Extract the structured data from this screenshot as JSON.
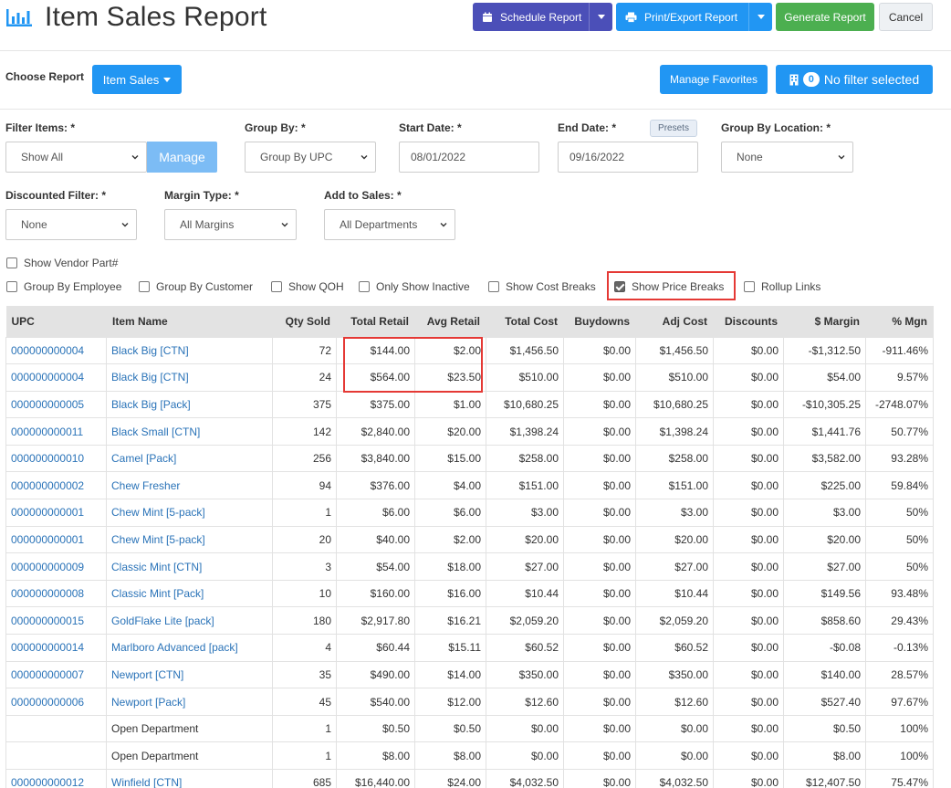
{
  "header": {
    "title": "Item Sales Report",
    "schedule_label": "Schedule Report",
    "print_label": "Print/Export Report",
    "generate_label": "Generate Report",
    "cancel_label": "Cancel"
  },
  "choose": {
    "label": "Choose Report",
    "report_value": "Item Sales",
    "manage_favorites": "Manage Favorites",
    "filter_count": "0",
    "filter_text": "No filter selected"
  },
  "filters": {
    "filter_items_label": "Filter Items: *",
    "filter_items_value": "Show All",
    "manage_label": "Manage",
    "group_by_label": "Group By: *",
    "group_by_value": "Group By UPC",
    "start_date_label": "Start Date: *",
    "start_date_value": "08/01/2022",
    "end_date_label": "End Date: *",
    "end_date_value": "09/16/2022",
    "presets_label": "Presets",
    "group_loc_label": "Group By Location: *",
    "group_loc_value": "None",
    "discounted_label": "Discounted Filter: *",
    "discounted_value": "None",
    "margin_label": "Margin Type: *",
    "margin_value": "All Margins",
    "add_sales_label": "Add to Sales: *",
    "add_sales_value": "All Departments"
  },
  "checkboxes": {
    "vendor_part": {
      "label": "Show Vendor Part#",
      "checked": false
    },
    "group_employee": {
      "label": "Group By Employee",
      "checked": false
    },
    "group_customer": {
      "label": "Group By Customer",
      "checked": false
    },
    "show_qoh": {
      "label": "Show QOH",
      "checked": false
    },
    "only_inactive": {
      "label": "Only Show Inactive",
      "checked": false
    },
    "cost_breaks": {
      "label": "Show Cost Breaks",
      "checked": false
    },
    "price_breaks": {
      "label": "Show Price Breaks",
      "checked": true
    },
    "rollup_links": {
      "label": "Rollup Links",
      "checked": false
    }
  },
  "table": {
    "columns": [
      "UPC",
      "Item Name",
      "Qty Sold",
      "Total Retail",
      "Avg Retail",
      "Total Cost",
      "Buydowns",
      "Adj Cost",
      "Discounts",
      "$ Margin",
      "% Mgn"
    ],
    "rows": [
      [
        "000000000004",
        "Black Big [CTN]",
        "72",
        "$144.00",
        "$2.00",
        "$1,456.50",
        "$0.00",
        "$1,456.50",
        "$0.00",
        "-$1,312.50",
        "-911.46%"
      ],
      [
        "000000000004",
        "Black Big [CTN]",
        "24",
        "$564.00",
        "$23.50",
        "$510.00",
        "$0.00",
        "$510.00",
        "$0.00",
        "$54.00",
        "9.57%"
      ],
      [
        "000000000005",
        "Black Big [Pack]",
        "375",
        "$375.00",
        "$1.00",
        "$10,680.25",
        "$0.00",
        "$10,680.25",
        "$0.00",
        "-$10,305.25",
        "-2748.07%"
      ],
      [
        "000000000011",
        "Black Small [CTN]",
        "142",
        "$2,840.00",
        "$20.00",
        "$1,398.24",
        "$0.00",
        "$1,398.24",
        "$0.00",
        "$1,441.76",
        "50.77%"
      ],
      [
        "000000000010",
        "Camel [Pack]",
        "256",
        "$3,840.00",
        "$15.00",
        "$258.00",
        "$0.00",
        "$258.00",
        "$0.00",
        "$3,582.00",
        "93.28%"
      ],
      [
        "000000000002",
        "Chew Fresher",
        "94",
        "$376.00",
        "$4.00",
        "$151.00",
        "$0.00",
        "$151.00",
        "$0.00",
        "$225.00",
        "59.84%"
      ],
      [
        "000000000001",
        "Chew Mint [5-pack]",
        "1",
        "$6.00",
        "$6.00",
        "$3.00",
        "$0.00",
        "$3.00",
        "$0.00",
        "$3.00",
        "50%"
      ],
      [
        "000000000001",
        "Chew Mint [5-pack]",
        "20",
        "$40.00",
        "$2.00",
        "$20.00",
        "$0.00",
        "$20.00",
        "$0.00",
        "$20.00",
        "50%"
      ],
      [
        "000000000009",
        "Classic Mint [CTN]",
        "3",
        "$54.00",
        "$18.00",
        "$27.00",
        "$0.00",
        "$27.00",
        "$0.00",
        "$27.00",
        "50%"
      ],
      [
        "000000000008",
        "Classic Mint [Pack]",
        "10",
        "$160.00",
        "$16.00",
        "$10.44",
        "$0.00",
        "$10.44",
        "$0.00",
        "$149.56",
        "93.48%"
      ],
      [
        "000000000015",
        "GoldFlake Lite [pack]",
        "180",
        "$2,917.80",
        "$16.21",
        "$2,059.20",
        "$0.00",
        "$2,059.20",
        "$0.00",
        "$858.60",
        "29.43%"
      ],
      [
        "000000000014",
        "Marlboro Advanced [pack]",
        "4",
        "$60.44",
        "$15.11",
        "$60.52",
        "$0.00",
        "$60.52",
        "$0.00",
        "-$0.08",
        "-0.13%"
      ],
      [
        "000000000007",
        "Newport [CTN]",
        "35",
        "$490.00",
        "$14.00",
        "$350.00",
        "$0.00",
        "$350.00",
        "$0.00",
        "$140.00",
        "28.57%"
      ],
      [
        "000000000006",
        "Newport [Pack]",
        "45",
        "$540.00",
        "$12.00",
        "$12.60",
        "$0.00",
        "$12.60",
        "$0.00",
        "$527.40",
        "97.67%"
      ],
      [
        "",
        "Open Department",
        "1",
        "$0.50",
        "$0.50",
        "$0.00",
        "$0.00",
        "$0.00",
        "$0.00",
        "$0.50",
        "100%"
      ],
      [
        "",
        "Open Department",
        "1",
        "$8.00",
        "$8.00",
        "$0.00",
        "$0.00",
        "$0.00",
        "$0.00",
        "$8.00",
        "100%"
      ],
      [
        "000000000012",
        "Winfield [CTN]",
        "685",
        "$16,440.00",
        "$24.00",
        "$4,032.50",
        "$0.00",
        "$4,032.50",
        "$0.00",
        "$12,407.50",
        "75.47%"
      ]
    ]
  },
  "colors": {
    "accent_blue": "#2196f3",
    "purple": "#4b4fb8",
    "green": "#4caf50",
    "link": "#2a73b8",
    "highlight": "#e53935"
  }
}
